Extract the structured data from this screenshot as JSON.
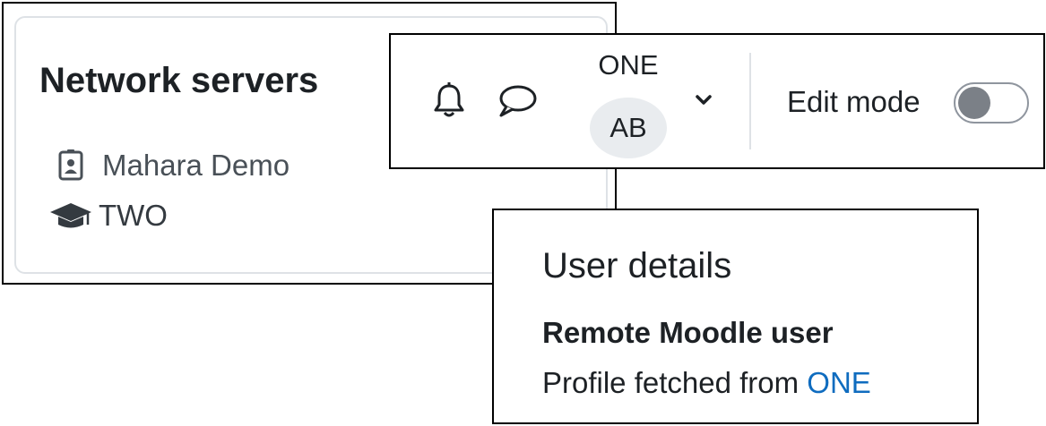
{
  "network_card": {
    "title": "Network servers",
    "rows": [
      {
        "icon": "id-badge-icon",
        "text": "Mahara Demo"
      },
      {
        "icon": "graduation-cap-icon",
        "text": "TWO"
      }
    ]
  },
  "navbar": {
    "icons": [
      "bell-icon",
      "chat-bubble-icon"
    ],
    "host_label": "ONE",
    "avatar_initials": "AB",
    "dropdown_icon": "chevron-down-icon",
    "edit_mode_label": "Edit mode",
    "edit_mode_on": false
  },
  "user_details": {
    "heading": "User details",
    "role": "Remote Moodle user",
    "profile_prefix": "Profile fetched from ",
    "profile_link": "ONE"
  },
  "colors": {
    "text": "#1d2125",
    "muted_text": "#495057",
    "link": "#0f6cbf",
    "avatar_bg": "#e9ecef",
    "card_border": "#dee2e6",
    "toggle_knob": "#7b8087"
  }
}
